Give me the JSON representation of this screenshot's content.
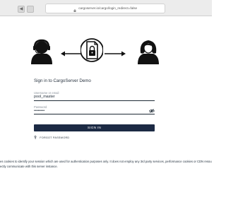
{
  "browser": {
    "url": "cargoserver.io/cargo/login_redirect=false"
  },
  "form": {
    "title": "Sign in to CargoServer Demo",
    "username_label": "Username or email",
    "username_value": "pool_master",
    "password_label": "Password",
    "password_value": "••••••••",
    "signin_label": "SIGN IN",
    "forgot_label": "FORGOT PASSWORD"
  },
  "notice": {
    "line1": "es cookies to identify your session which are used for authentication purposes only. It does not employ any 3rd party services, performance cookies or CDN resources",
    "line2": "ectly communicate with this server instance."
  },
  "colors": {
    "button": "#1c2a44",
    "text": "#1f2d3a"
  }
}
